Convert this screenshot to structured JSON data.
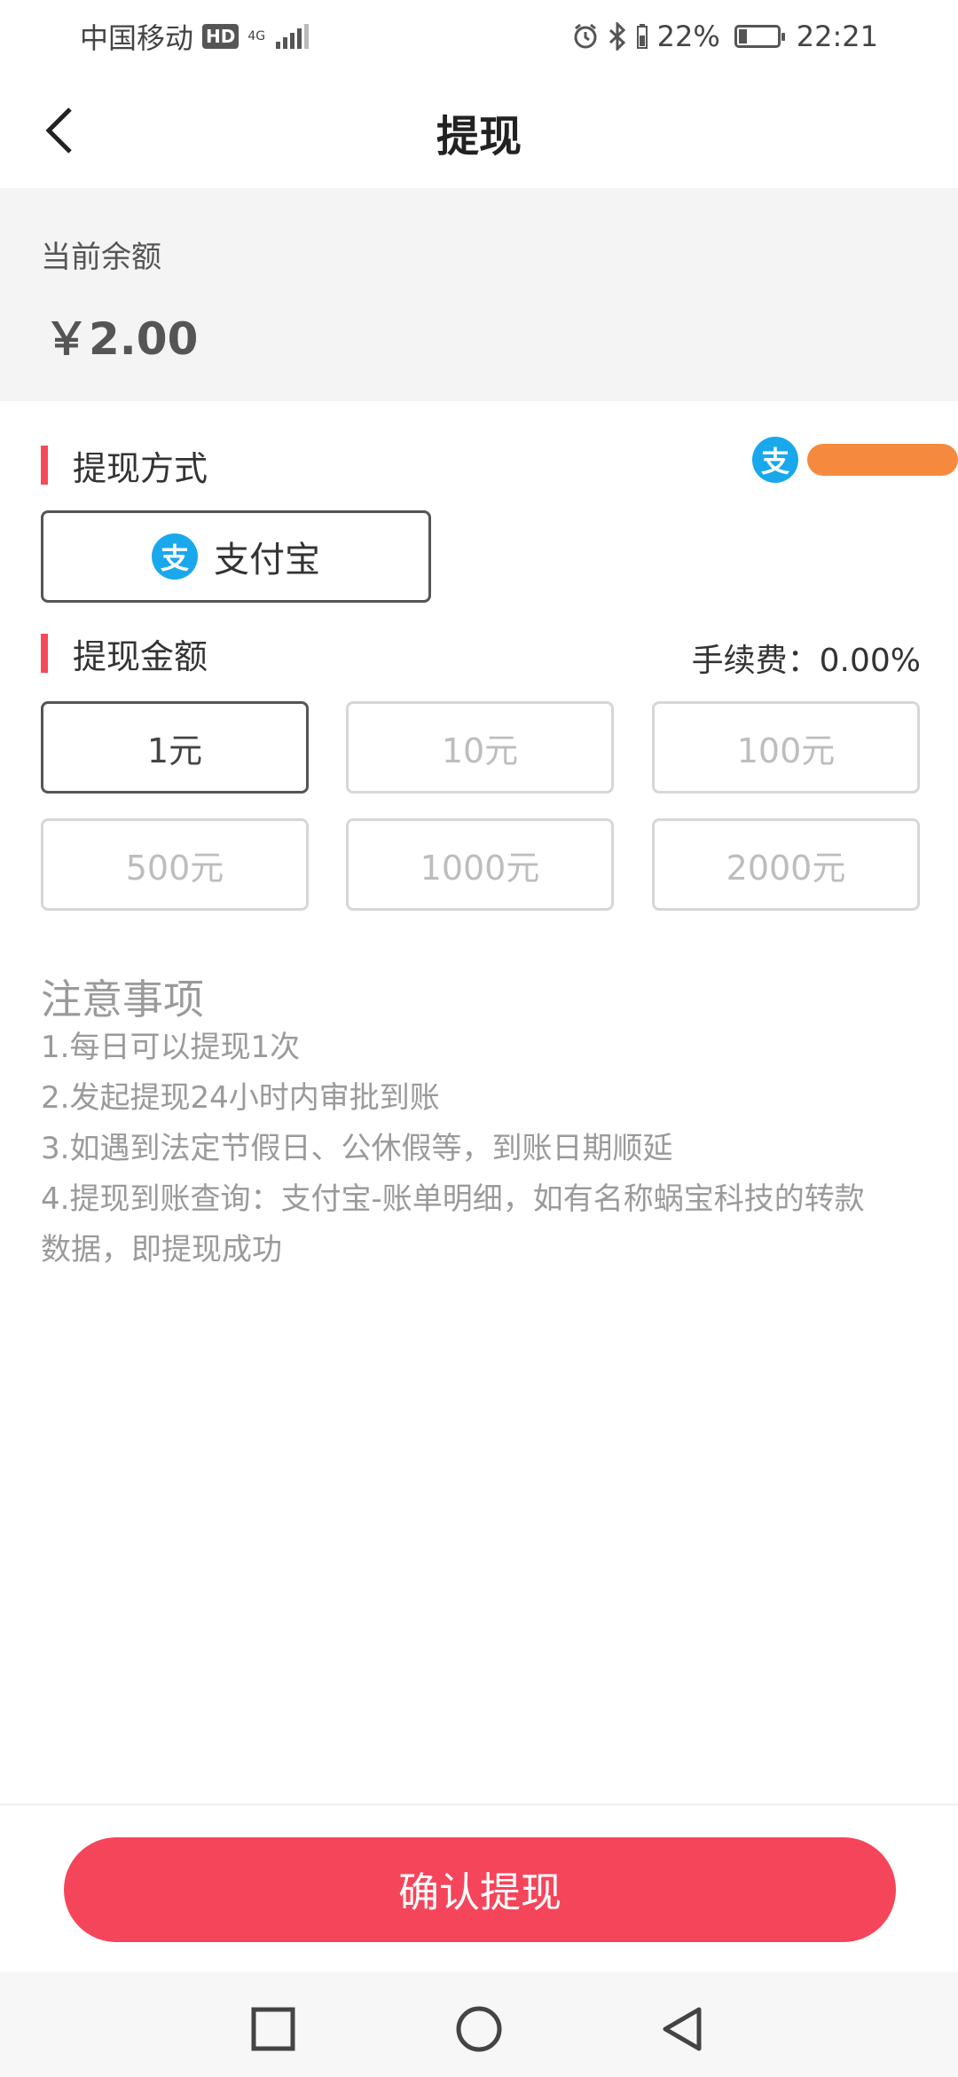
{
  "status_bar": {
    "carrier": "中国移动",
    "hd": "HD",
    "network": "4G",
    "battery_percent": "22%",
    "time": "22:21",
    "battery_level": 0.22
  },
  "nav": {
    "title": "提现",
    "back_icon": "chevron-left-icon"
  },
  "balance": {
    "label": "当前余额",
    "amount": "￥2.00"
  },
  "method_section": {
    "title": "提现方式",
    "account_icon_char": "支",
    "method_icon_char": "支",
    "method_label": "支付宝",
    "accent_color": "#f44a5a",
    "alipay_color": "#1aa8ec"
  },
  "amount_section": {
    "title": "提现金额",
    "fee": "手续费：0.00%",
    "options": [
      {
        "label": "1元",
        "selected": true
      },
      {
        "label": "10元",
        "selected": false
      },
      {
        "label": "100元",
        "selected": false
      },
      {
        "label": "500元",
        "selected": false
      },
      {
        "label": "1000元",
        "selected": false
      },
      {
        "label": "2000元",
        "selected": false
      }
    ]
  },
  "notes": {
    "title": "注意事项",
    "lines": [
      "1.每日可以提现1次",
      "2.发起提现24小时内审批到账",
      "3.如遇到法定节假日、公休假等，到账日期顺延",
      "4.提现到账查询：支付宝-账单明细，如有名称蜗宝科技的转款",
      "数据，即提现成功"
    ]
  },
  "confirm_button": {
    "label": "确认提现",
    "color": "#f5455a"
  },
  "system_nav": {
    "icons": [
      "square-icon",
      "circle-icon",
      "triangle-back-icon"
    ]
  }
}
